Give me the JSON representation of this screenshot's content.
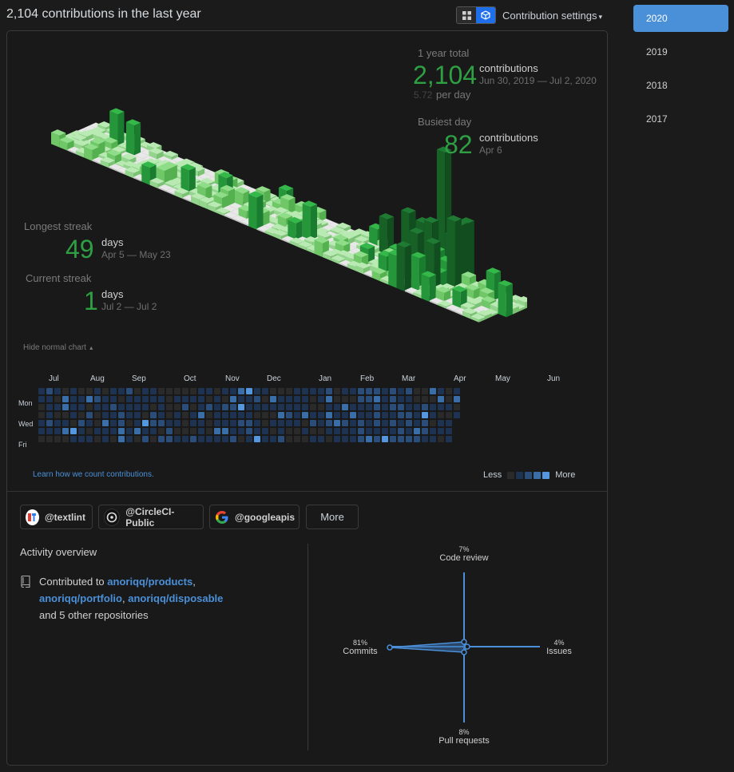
{
  "header": {
    "title": "2,104 contributions in the last year",
    "settings_label": "Contribution settings"
  },
  "years": [
    "2020",
    "2019",
    "2018",
    "2017"
  ],
  "active_year": "2020",
  "stats": {
    "year_total": {
      "label": "1 year total",
      "value": "2,104",
      "unit": "contributions",
      "range": "Jun 30, 2019 — Jul 2, 2020",
      "per_day_value": "5.72",
      "per_day_label": "per day"
    },
    "busiest_day": {
      "label": "Busiest day",
      "value": "82",
      "unit": "contributions",
      "date": "Apr 6"
    },
    "longest_streak": {
      "label": "Longest streak",
      "value": "49",
      "unit": "days",
      "range": "Apr 5 — May 23"
    },
    "current_streak": {
      "label": "Current streak",
      "value": "1",
      "unit": "days",
      "range": "Jul 2 — Jul 2"
    }
  },
  "hide_chart_label": "Hide normal chart",
  "graph": {
    "months": [
      "Jul",
      "Aug",
      "Sep",
      "Oct",
      "Nov",
      "Dec",
      "Jan",
      "Feb",
      "Mar",
      "Apr",
      "May",
      "Jun"
    ],
    "day_labels": [
      "Mon",
      "Wed",
      "Fri"
    ],
    "level_colors": [
      "#2a2a2a",
      "#1e3352",
      "#2a4d7a",
      "#3a6ea8",
      "#5597de"
    ],
    "learn_text": "Learn how we count contributions.",
    "legend_less": "Less",
    "legend_more": "More"
  },
  "orgs": [
    {
      "name": "@textlint",
      "icon": "textlint-logo-icon"
    },
    {
      "name": "@CircleCI-Public",
      "icon": "circleci-logo-icon"
    },
    {
      "name": "@googleapis",
      "icon": "google-logo-icon"
    }
  ],
  "orgs_more": "More",
  "activity": {
    "title": "Activity overview",
    "prefix": "Contributed to",
    "repos": [
      "anoriqq/products",
      "anoriqq/portfolio",
      "anoriqq/disposable"
    ],
    "suffix": "and 5 other repositories",
    "radar": {
      "code_review": {
        "label": "Code review",
        "pct": "7%"
      },
      "issues": {
        "label": "Issues",
        "pct": "4%"
      },
      "pull_requests": {
        "label": "Pull requests",
        "pct": "8%"
      },
      "commits": {
        "label": "Commits",
        "pct": "81%"
      }
    }
  }
}
